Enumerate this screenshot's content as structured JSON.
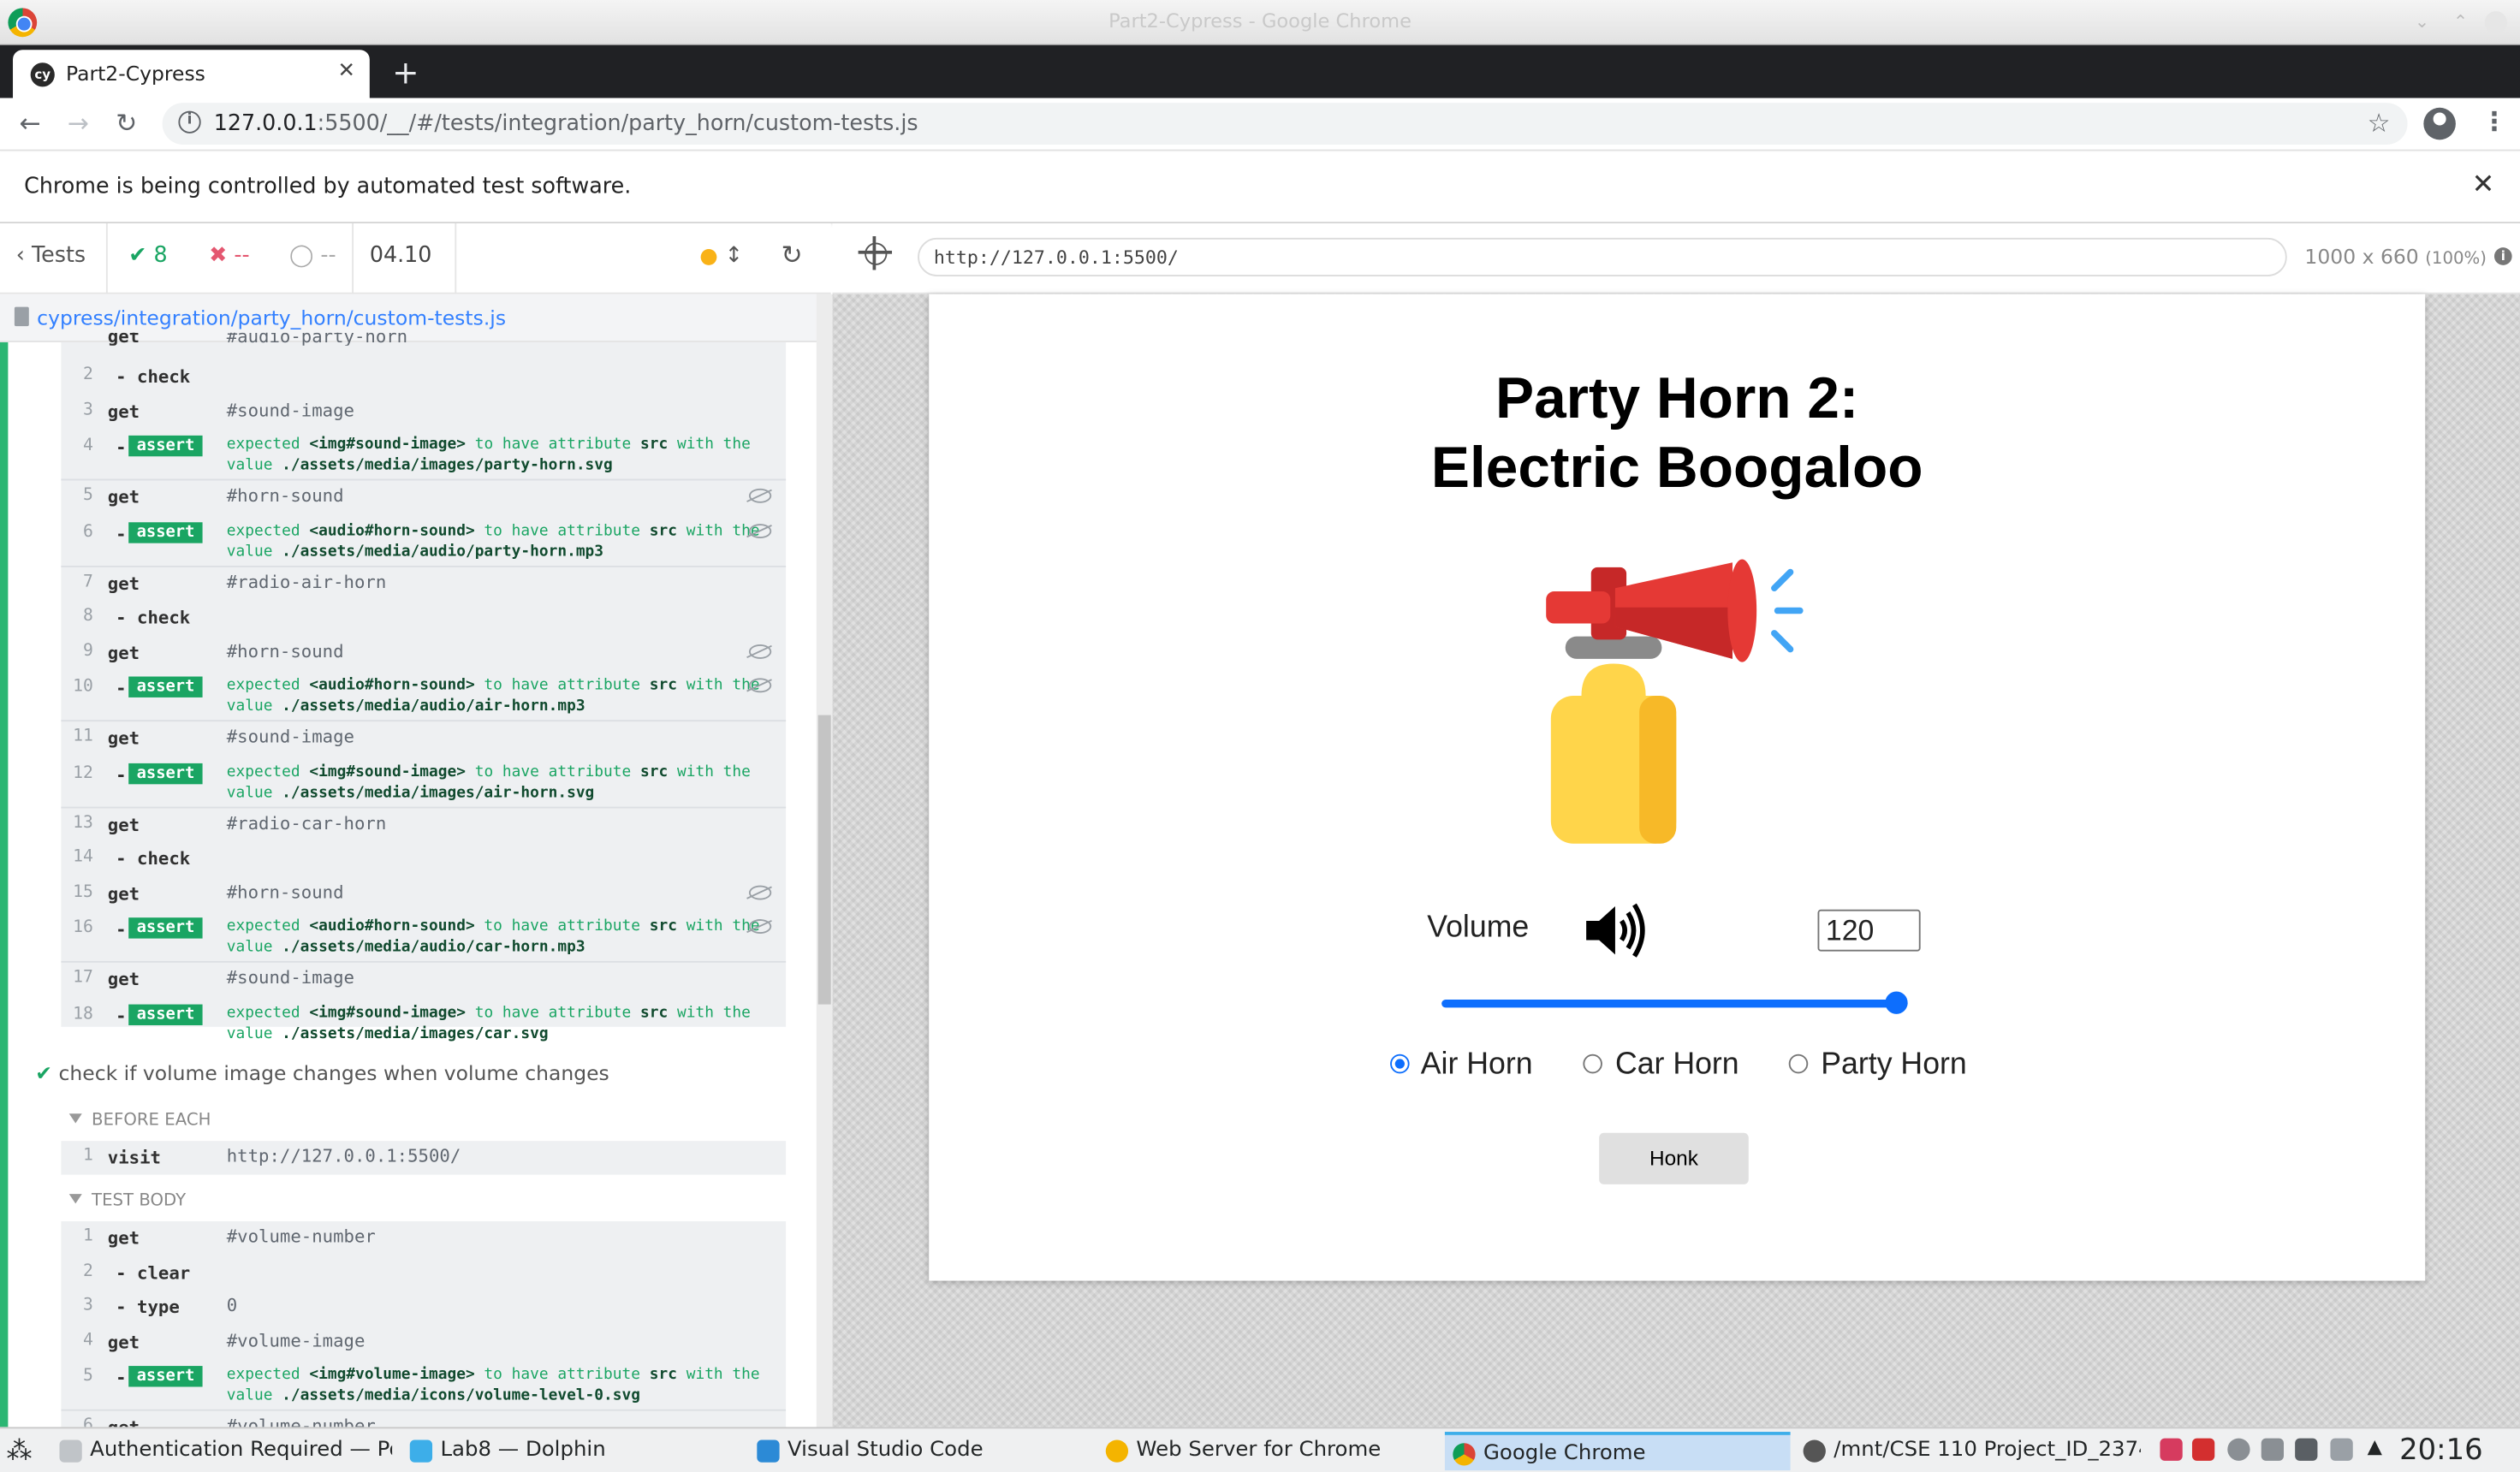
{
  "window": {
    "title": "Part2-Cypress - Google Chrome"
  },
  "browser": {
    "tab_title": "Part2-Cypress",
    "tab_favicon": "cy",
    "url_host": "127.0.0.1",
    "url_rest": ":5500/__/#/tests/integration/party_horn/custom-tests.js",
    "infobar_message": "Chrome is being controlled by automated test software."
  },
  "reporter": {
    "tests_label": "Tests",
    "passed": "8",
    "failed": "--",
    "pending": "--",
    "duration": "04.10",
    "spec_path": "cypress/integration/party_horn/custom-tests.js",
    "test1_commands": [
      {
        "num": "2",
        "name": "- check",
        "message": "",
        "child": true
      },
      {
        "num": "3",
        "name": "get",
        "message": "#sound-image"
      },
      {
        "num": "4",
        "assert": true,
        "pre": "expected ",
        "subject": "<img#sound-image>",
        "mid": " to have attribute ",
        "attr": "src",
        "post": " with the value ",
        "val": "./assets/media/images/party-horn.svg"
      },
      {
        "num": "5",
        "name": "get",
        "message": "#horn-sound",
        "eye": true
      },
      {
        "num": "6",
        "assert": true,
        "pre": "expected ",
        "subject": "<audio#horn-sound>",
        "mid": " to have attribute ",
        "attr": "src",
        "post": " with the value ",
        "val": "./assets/media/audio/party-horn.mp3",
        "eye": true
      },
      {
        "num": "7",
        "name": "get",
        "message": "#radio-air-horn"
      },
      {
        "num": "8",
        "name": "- check",
        "message": "",
        "child": true
      },
      {
        "num": "9",
        "name": "get",
        "message": "#horn-sound",
        "eye": true
      },
      {
        "num": "10",
        "assert": true,
        "pre": "expected ",
        "subject": "<audio#horn-sound>",
        "mid": " to have attribute ",
        "attr": "src",
        "post": " with the value ",
        "val": "./assets/media/audio/air-horn.mp3",
        "eye": true
      },
      {
        "num": "11",
        "name": "get",
        "message": "#sound-image"
      },
      {
        "num": "12",
        "assert": true,
        "pre": "expected ",
        "subject": "<img#sound-image>",
        "mid": " to have attribute ",
        "attr": "src",
        "post": " with the value ",
        "val": "./assets/media/images/air-horn.svg"
      },
      {
        "num": "13",
        "name": "get",
        "message": "#radio-car-horn"
      },
      {
        "num": "14",
        "name": "- check",
        "message": "",
        "child": true
      },
      {
        "num": "15",
        "name": "get",
        "message": "#horn-sound",
        "eye": true
      },
      {
        "num": "16",
        "assert": true,
        "pre": "expected ",
        "subject": "<audio#horn-sound>",
        "mid": " to have attribute ",
        "attr": "src",
        "post": " with the value ",
        "val": "./assets/media/audio/car-horn.mp3",
        "eye": true
      },
      {
        "num": "17",
        "name": "get",
        "message": "#sound-image"
      },
      {
        "num": "18",
        "assert": true,
        "pre": "expected ",
        "subject": "<img#sound-image>",
        "mid": " to have attribute ",
        "attr": "src",
        "post": " with the value ",
        "val": "./assets/media/images/car.svg"
      }
    ],
    "test2_title": "check if volume image changes when volume changes",
    "before_each_label": "BEFORE EACH",
    "before_each_commands": [
      {
        "num": "1",
        "name": "visit",
        "message": "http://127.0.0.1:5500/"
      }
    ],
    "test_body_label": "TEST BODY",
    "test2_commands": [
      {
        "num": "1",
        "name": "get",
        "message": "#volume-number"
      },
      {
        "num": "2",
        "name": "- clear",
        "message": "",
        "child": true
      },
      {
        "num": "3",
        "name": "- type",
        "message": "0",
        "child": true
      },
      {
        "num": "4",
        "name": "get",
        "message": "#volume-image"
      },
      {
        "num": "5",
        "assert": true,
        "pre": "expected ",
        "subject": "<img#volume-image>",
        "mid": " to have attribute ",
        "attr": "src",
        "post": " with the value ",
        "val": "./assets/media/icons/volume-level-0.svg"
      },
      {
        "num": "6",
        "name": "get",
        "message": "#volume-number"
      }
    ]
  },
  "aut": {
    "url": "http://127.0.0.1:5500/",
    "viewport": "1000 x 660",
    "scale": "(100%)",
    "heading_line1": "Party Horn 2:",
    "heading_line2": "Electric Boogaloo",
    "volume_label": "Volume",
    "volume_value": "120",
    "slider_fraction": 1.0,
    "radios": [
      {
        "label": "Air Horn",
        "checked": true
      },
      {
        "label": "Car Horn",
        "checked": false
      },
      {
        "label": "Party Horn",
        "checked": false
      }
    ],
    "honk_label": "Honk"
  },
  "taskbar": {
    "tasks": [
      {
        "label": "Authentication Required — Po...",
        "active": false
      },
      {
        "label": "Lab8 — Dolphin",
        "active": false
      },
      {
        "label": "Visual Studio Code",
        "active": false
      },
      {
        "label": "Web Server for Chrome",
        "active": false
      },
      {
        "label": "Google Chrome",
        "active": true
      },
      {
        "label": "/mnt/CSE 110 Project_ID_2374...",
        "active": false
      }
    ],
    "clock": "20:16"
  },
  "colors": {
    "cypress_green": "#1aa563",
    "link_blue": "#3380FF",
    "accent": "#0d6efd"
  }
}
